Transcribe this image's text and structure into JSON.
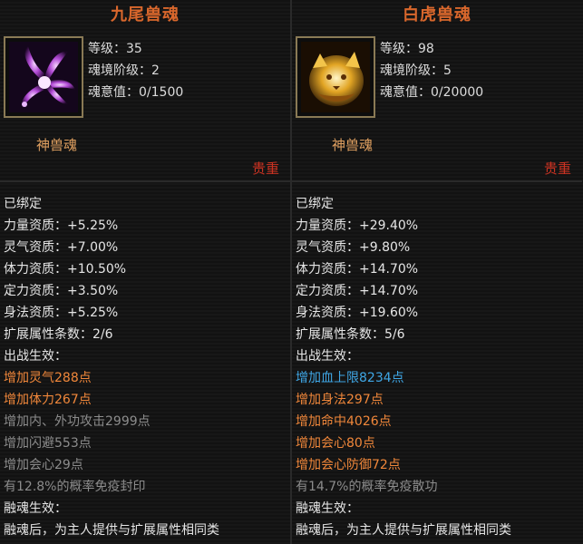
{
  "panels": [
    {
      "title": "九尾兽魂",
      "stats": {
        "level": "等级：35",
        "realm_stage": "魂境阶级：2",
        "soul_value": "魂意值：0/1500"
      },
      "kind": "神兽魂",
      "grade": "贵重",
      "bound": "已绑定",
      "attributes": [
        "力量资质：+5.25%",
        "灵气资质：+7.00%",
        "体力资质：+10.50%",
        "定力资质：+3.50%",
        "身法资质：+5.25%"
      ],
      "ext_count": "扩展属性条数：2/6",
      "battle_header": "出战生效：",
      "effects": [
        {
          "text": "增加灵气288点",
          "color": "#f0873a"
        },
        {
          "text": "增加体力267点",
          "color": "#f0873a"
        },
        {
          "text": "增加内、外功攻击2999点",
          "color": "#8c8c8c"
        },
        {
          "text": "增加闪避553点",
          "color": "#8c8c8c"
        },
        {
          "text": "增加会心29点",
          "color": "#8c8c8c"
        },
        {
          "text": "有12.8%的概率免疫封印",
          "color": "#8c8c8c"
        }
      ],
      "fusion_header": "融魂生效：",
      "fusion_text": "融魂后，为主人提供与扩展属性相同类"
    },
    {
      "title": "白虎兽魂",
      "stats": {
        "level": "等级：98",
        "realm_stage": "魂境阶级：5",
        "soul_value": "魂意值：0/20000"
      },
      "kind": "神兽魂",
      "grade": "贵重",
      "bound": "已绑定",
      "attributes": [
        "力量资质：+29.40%",
        "灵气资质：+9.80%",
        "体力资质：+14.70%",
        "定力资质：+14.70%",
        "身法资质：+19.60%"
      ],
      "ext_count": "扩展属性条数：5/6",
      "battle_header": "出战生效：",
      "effects": [
        {
          "text": "增加血上限8234点",
          "color": "#3fa7e6"
        },
        {
          "text": "增加身法297点",
          "color": "#f0873a"
        },
        {
          "text": "增加命中4026点",
          "color": "#f0873a"
        },
        {
          "text": "增加会心80点",
          "color": "#f0873a"
        },
        {
          "text": "增加会心防御72点",
          "color": "#f0873a"
        },
        {
          "text": "有14.7%的概率免疫散功",
          "color": "#8c8c8c"
        }
      ],
      "fusion_header": "融魂生效：",
      "fusion_text": "融魂后，为主人提供与扩展属性相同类"
    }
  ]
}
